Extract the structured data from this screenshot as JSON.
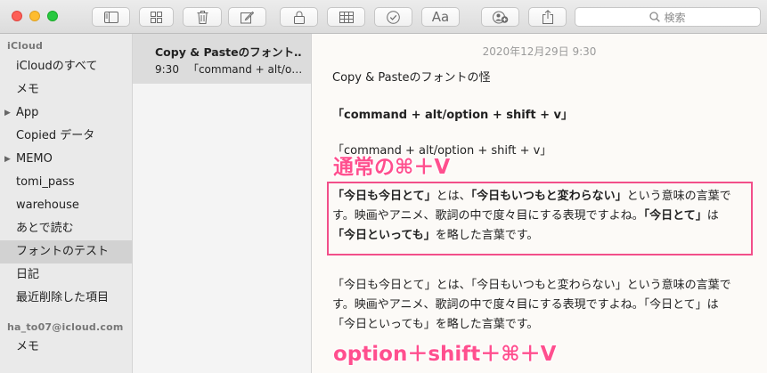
{
  "toolbar": {
    "search_placeholder": "検索",
    "font_button_label": "Aa"
  },
  "sidebar": {
    "sections": [
      {
        "header": "iCloud",
        "items": [
          {
            "label": "iCloudのすべて",
            "disclosure": false,
            "selected": false
          },
          {
            "label": "メモ",
            "disclosure": false,
            "selected": false
          },
          {
            "label": "App",
            "disclosure": true,
            "selected": false
          },
          {
            "label": "Copied データ",
            "disclosure": false,
            "selected": false
          },
          {
            "label": "MEMO",
            "disclosure": true,
            "selected": false
          },
          {
            "label": "tomi_pass",
            "disclosure": false,
            "selected": false
          },
          {
            "label": "warehouse",
            "disclosure": false,
            "selected": false
          },
          {
            "label": "あとで読む",
            "disclosure": false,
            "selected": false
          },
          {
            "label": "フォントのテスト",
            "disclosure": false,
            "selected": true
          },
          {
            "label": "日記",
            "disclosure": false,
            "selected": false
          },
          {
            "label": "最近削除した項目",
            "disclosure": false,
            "selected": false
          }
        ]
      },
      {
        "header": "ha_to07@icloud.com",
        "items": [
          {
            "label": "メモ",
            "disclosure": false,
            "selected": false
          }
        ]
      }
    ]
  },
  "note_list": {
    "items": [
      {
        "title": "Copy & Pasteのフォント…",
        "time": "9:30",
        "preview": "「command + alt/o…"
      }
    ]
  },
  "editor": {
    "date": "2020年12月29日 9:30",
    "title_line": "Copy & Pasteのフォントの怪",
    "bold_line": "「command + alt/option + shift + v」",
    "plain_line": "「command + alt/option + shift + v」",
    "para1": {
      "l1_b1": "「今日も今日とて」",
      "l1_t1": "とは、",
      "l1_b2": "「今日もいつもと変わらない」",
      "l1_t2": "という意味の言葉で",
      "l2_t1": "す。映画やアニメ、歌詞の中で度々目にする表現ですよね。",
      "l2_b1": "「今日とて」",
      "l2_t2": "は",
      "l3_b1": "「今日といっても」",
      "l3_t1": "を略した言葉です。"
    },
    "para2": {
      "line1": "「今日も今日とて」とは、「今日もいつもと変わらない」という意味の言葉で",
      "line2": "す。映画やアニメ、歌詞の中で度々目にする表現ですよね。「今日とて」は",
      "line3": "「今日といっても」を略した言葉です。"
    }
  },
  "annotations": {
    "label1": "通常の⌘＋V",
    "label2": "option＋shift＋⌘＋V",
    "color": "#ff4f8e"
  }
}
